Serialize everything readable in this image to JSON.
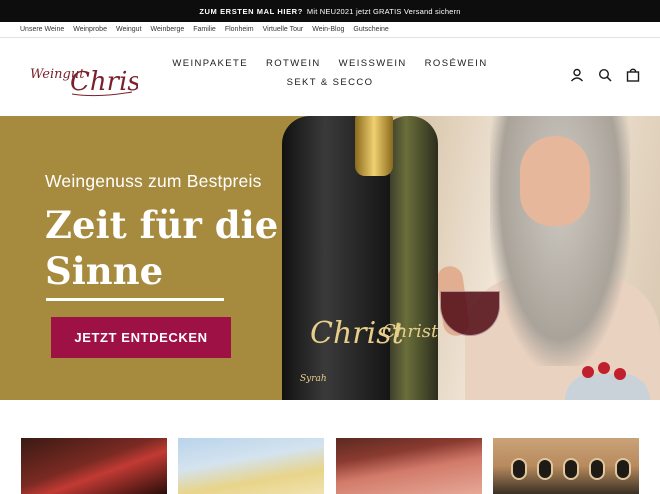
{
  "announcement": {
    "bold": "ZUM ERSTEN MAL HIER?",
    "text": "Mit NEU2021 jetzt GRATIS Versand sichern"
  },
  "top_links": [
    "Unsere Weine",
    "Weinprobe",
    "Weingut",
    "Weinberge",
    "Familie",
    "Flonheim",
    "Virtuelle Tour",
    "Wein-Blog",
    "Gutscheine"
  ],
  "logo": {
    "line1": "Weingut",
    "line2": "Christ"
  },
  "nav": {
    "row1": [
      "WEINPAKETE",
      "ROTWEIN",
      "WEISSWEIN",
      "ROSÉWEIN"
    ],
    "row2": [
      "SEKT & SECCO"
    ]
  },
  "header_icons": [
    "account-icon",
    "search-icon",
    "cart-icon"
  ],
  "hero": {
    "subtitle": "Weingenuss zum Bestpreis",
    "title_line1": "Zeit für die",
    "title_line2": "Sinne",
    "button": "JETZT ENTDECKEN",
    "bottle_label_front": "Christ",
    "bottle_label_back": "Christ",
    "bottle_small_text": "Syrah"
  },
  "colors": {
    "announcement_bg": "#0d0d0d",
    "hero_bg": "#a68a3e",
    "button_bg": "#9e1145",
    "logo_color": "#7a1f2b"
  }
}
